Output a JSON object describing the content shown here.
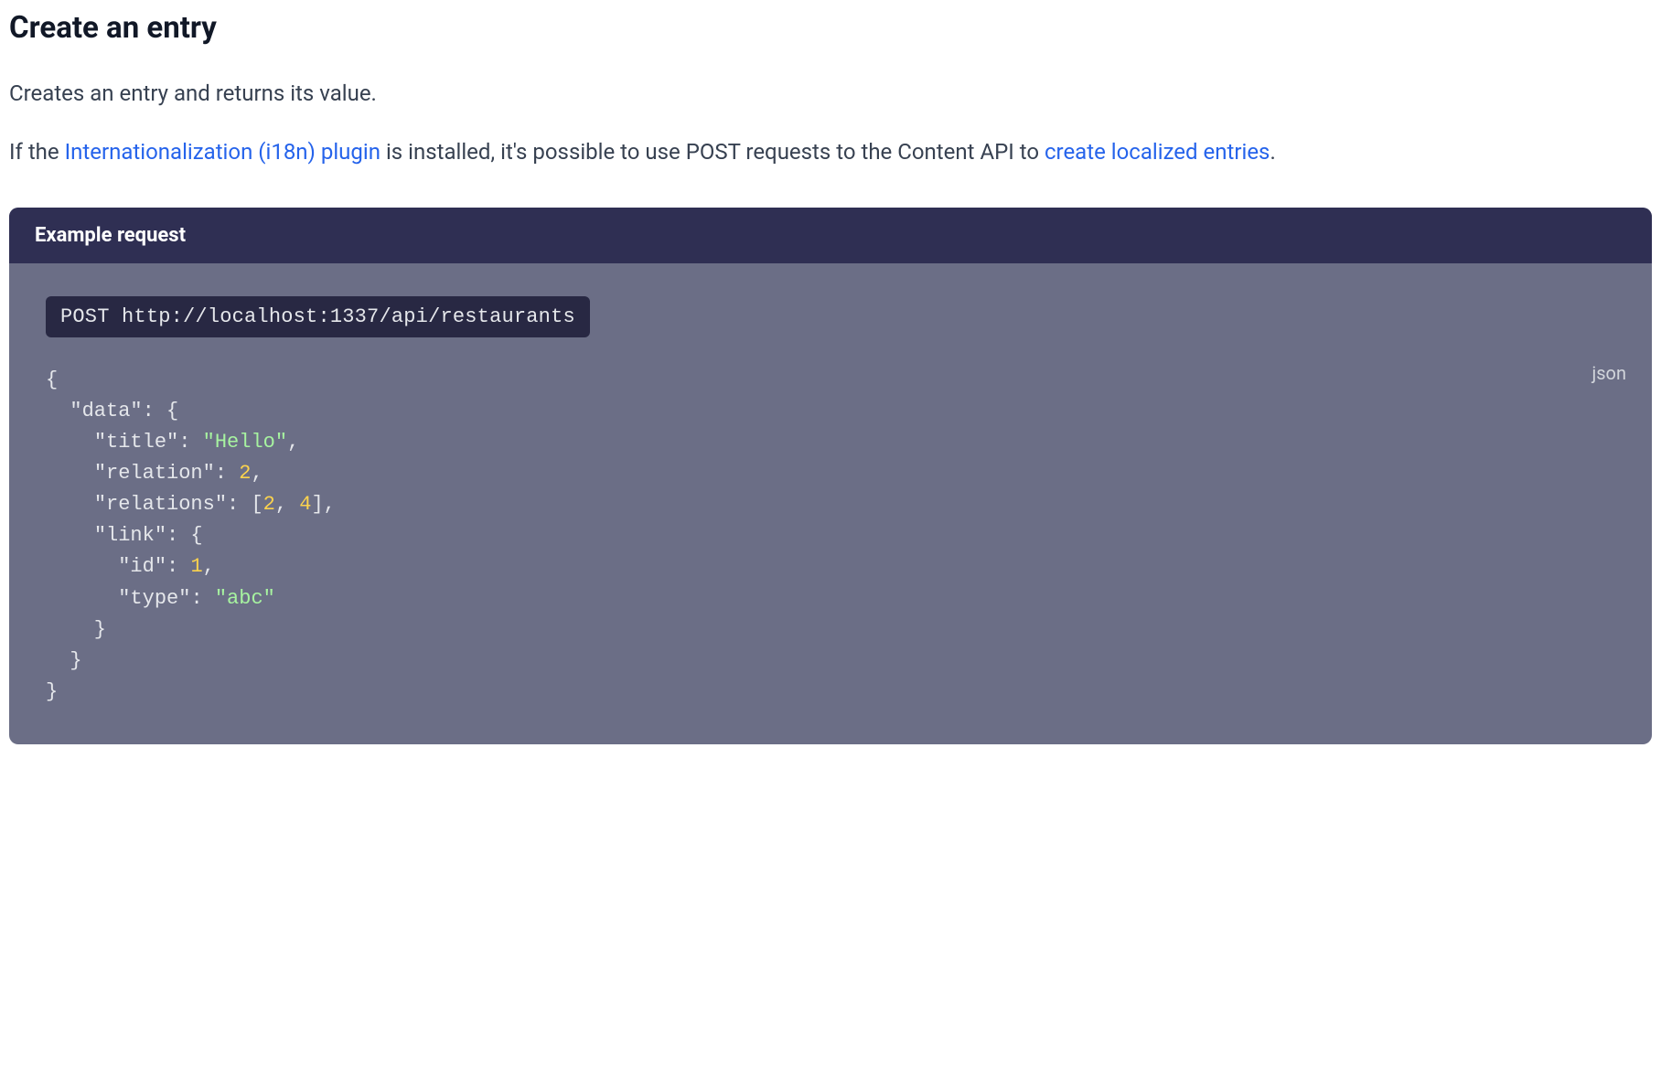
{
  "heading": "Create an entry",
  "para1": "Creates an entry and returns its value.",
  "para2": {
    "t1": "If the ",
    "link1": "Internationalization (i18n) plugin",
    "t2": " is installed, it's possible to use POST requests to the Content API to ",
    "link2": "create localized entries",
    "t3": "."
  },
  "panel": {
    "title": "Example request",
    "endpoint": "POST http://localhost:1337/api/restaurants",
    "lang": "json"
  },
  "code": {
    "l1": "{",
    "l2_key": "\"data\"",
    "l2_rest": ": {",
    "l3_key": "\"title\"",
    "l3_sep": ": ",
    "l3_val": "\"Hello\"",
    "l3_end": ",",
    "l4_key": "\"relation\"",
    "l4_sep": ": ",
    "l4_val": "2",
    "l4_end": ",",
    "l5_key": "\"relations\"",
    "l5_sep": ": [",
    "l5_v1": "2",
    "l5_mid": ", ",
    "l5_v2": "4",
    "l5_end": "],",
    "l6_key": "\"link\"",
    "l6_rest": ": {",
    "l7_key": "\"id\"",
    "l7_sep": ": ",
    "l7_val": "1",
    "l7_end": ",",
    "l8_key": "\"type\"",
    "l8_sep": ": ",
    "l8_val": "\"abc\"",
    "l9": "    }",
    "l10": "  }",
    "l11": "}"
  }
}
